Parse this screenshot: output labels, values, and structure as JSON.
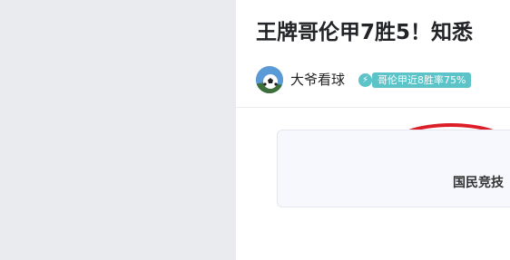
{
  "article": {
    "title": "王牌哥伦甲7胜5！知悉",
    "author": {
      "name": "大爷看球"
    },
    "tag": {
      "label": "哥伦甲近8胜率75%"
    },
    "card": {
      "text": "国民竞技"
    }
  },
  "icons": {
    "avatar": "soccer-ball-avatar",
    "tag_icon": "lightning-icon",
    "extra_icon": "star-icon"
  },
  "colors": {
    "sidebar": "#e9ebef",
    "tag_badge": "#5cc3c8",
    "star_badge": "#f0a640",
    "annotation": "#dc1e29",
    "card_bg": "#f7f8fd"
  }
}
